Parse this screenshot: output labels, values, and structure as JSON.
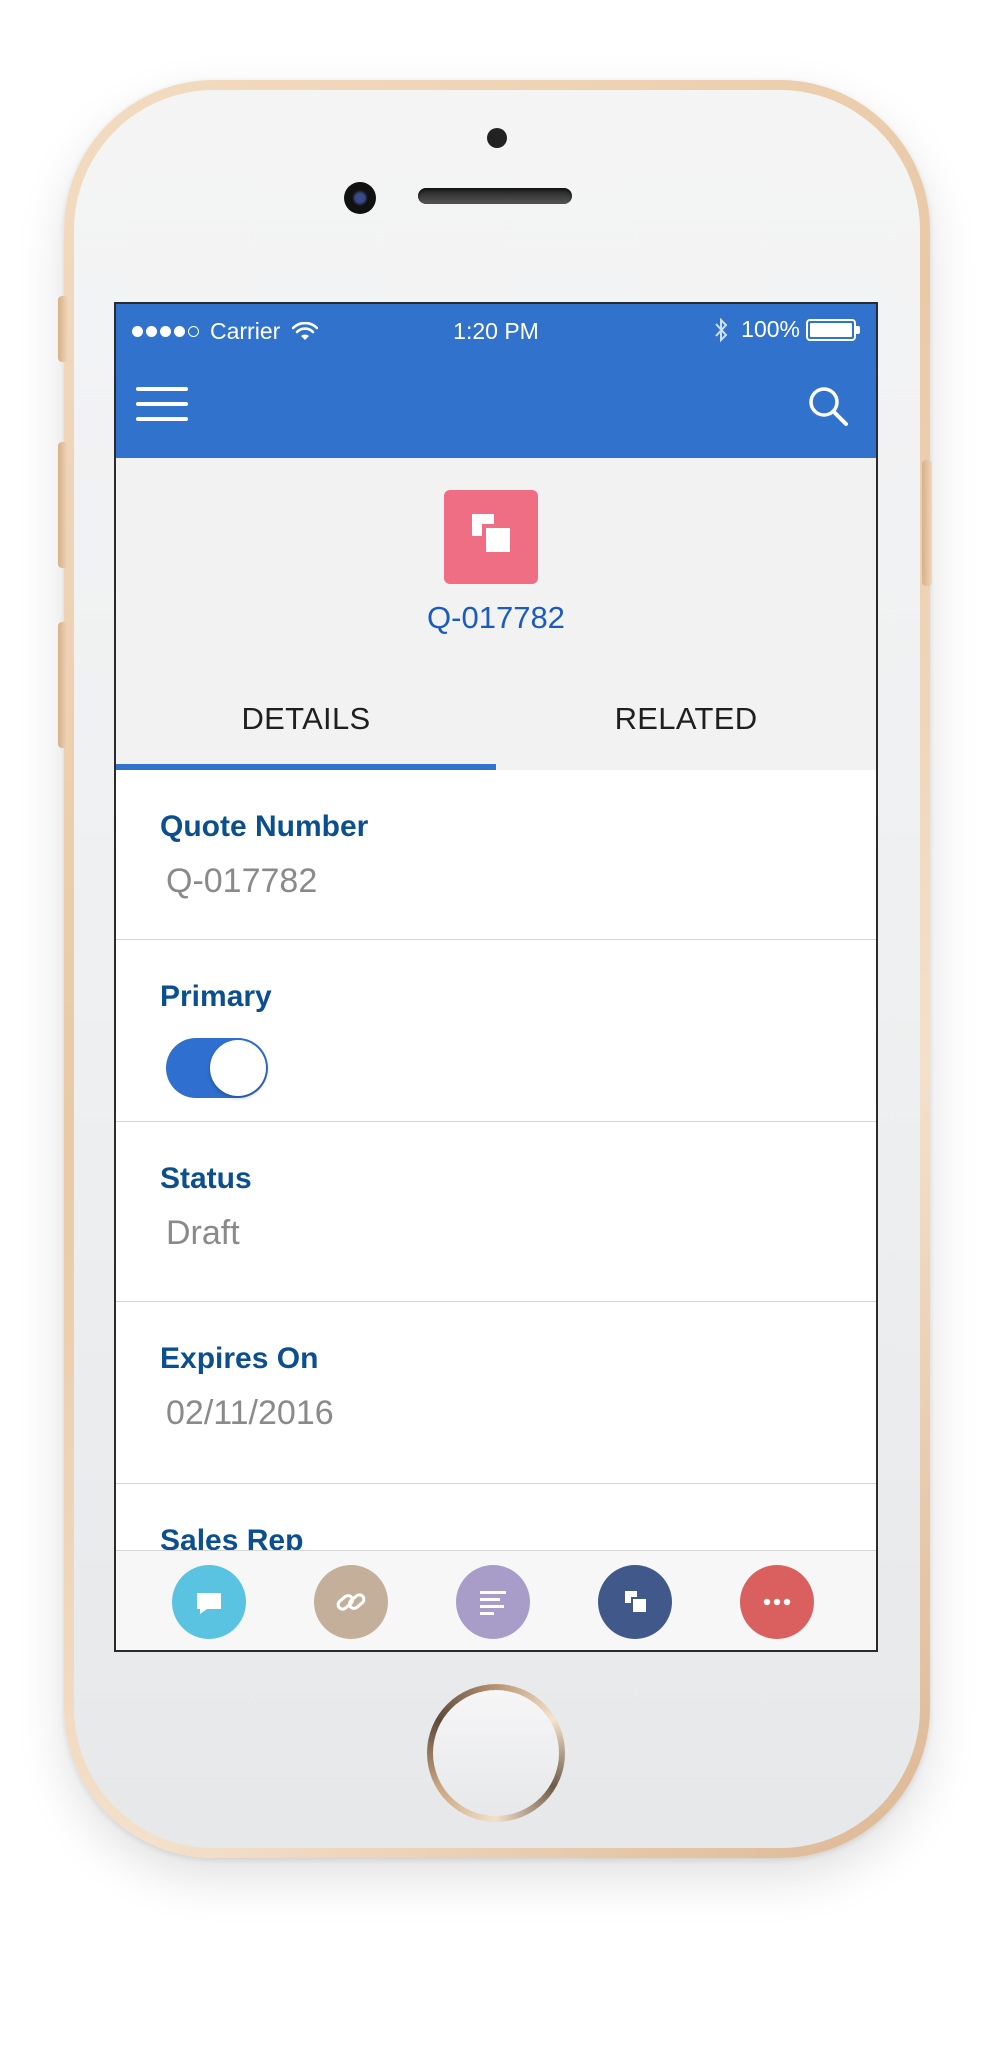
{
  "status_bar": {
    "carrier": "Carrier",
    "time": "1:20 PM",
    "battery": "100%"
  },
  "nav": {
    "menu_icon": "hamburger-icon",
    "search_icon": "search-icon"
  },
  "record": {
    "icon": "quote-icon",
    "icon_color": "#ef6e84",
    "title": "Q-017782"
  },
  "tabs": [
    {
      "label": "DETAILS",
      "selected": true
    },
    {
      "label": "RELATED",
      "selected": false
    }
  ],
  "fields": {
    "quote_number": {
      "label": "Quote Number",
      "value": "Q-017782"
    },
    "primary": {
      "label": "Primary",
      "checked": true
    },
    "status": {
      "label": "Status",
      "value": "Draft"
    },
    "expires_on": {
      "label": "Expires On",
      "value": "02/11/2016"
    },
    "sales_rep": {
      "label": "Sales Rep"
    }
  },
  "action_bar": [
    {
      "icon": "chat-icon",
      "color": "#5bc3e2"
    },
    {
      "icon": "link-icon",
      "color": "#c4b09a"
    },
    {
      "icon": "notes-icon",
      "color": "#a89dc9"
    },
    {
      "icon": "quote-icon",
      "color": "#41598a"
    },
    {
      "icon": "more-icon",
      "color": "#d9605f"
    }
  ],
  "colors": {
    "brand_blue": "#3072cc",
    "label_blue": "#0b4f8f",
    "title_blue": "#1a5bbd"
  }
}
